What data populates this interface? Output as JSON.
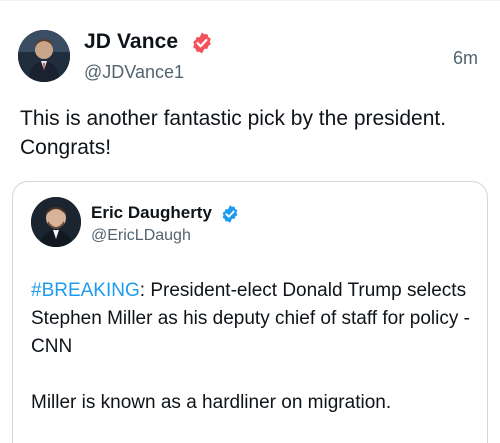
{
  "tweet": {
    "author_name": "JD Vance",
    "author_handle": "@JDVance1",
    "timestamp": "6m",
    "text": "This is another fantastic pick by the president. Congrats!",
    "avatar_icon": "user-avatar-photo",
    "verified_icon": "verified-badge-icon",
    "verified_color": "#f4515c"
  },
  "quoted_tweet": {
    "author_name": "Eric Daugherty",
    "author_handle": "@EricLDaugh",
    "hashtag": "#BREAKING",
    "line1_rest": ": President-elect Donald Trump selects Stephen Miller as his deputy chief of staff for policy - CNN",
    "paragraph2": "Miller is known as a hardliner on migration.",
    "avatar_icon": "user-avatar-photo",
    "verified_icon": "verified-badge-icon",
    "verified_color": "#1d9bf0",
    "hashtag_color": "#1d9bf0"
  }
}
